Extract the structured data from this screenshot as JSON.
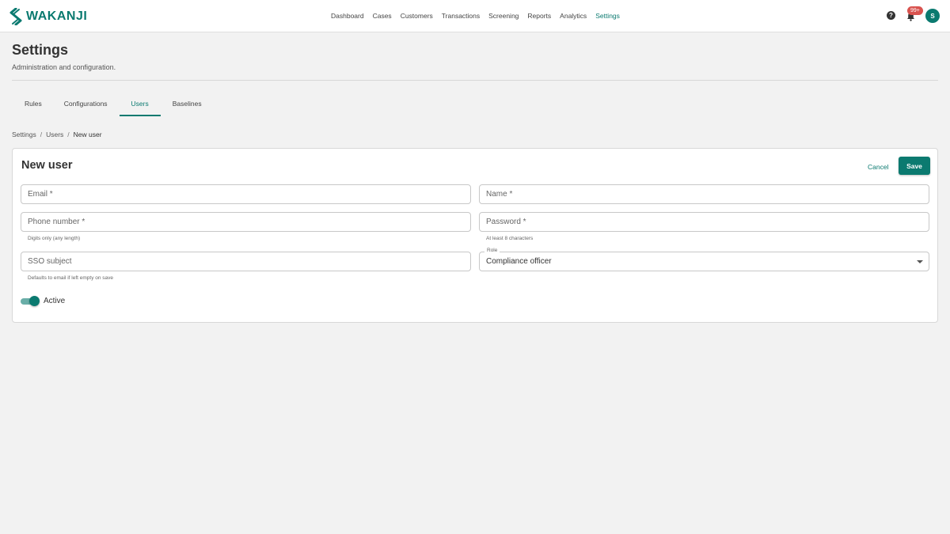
{
  "brand": {
    "name": "WAKANJI",
    "color": "#0b7a70"
  },
  "nav": {
    "items": [
      {
        "label": "Dashboard"
      },
      {
        "label": "Cases"
      },
      {
        "label": "Customers"
      },
      {
        "label": "Transactions"
      },
      {
        "label": "Screening"
      },
      {
        "label": "Reports"
      },
      {
        "label": "Analytics"
      },
      {
        "label": "Settings",
        "active": true
      }
    ],
    "help_icon": "help-circle-icon",
    "bell_icon": "bell-icon",
    "notification_badge": "99+",
    "avatar_initial": "S"
  },
  "header": {
    "title": "Settings",
    "subtitle": "Administration and configuration."
  },
  "tabs": [
    {
      "label": "Rules"
    },
    {
      "label": "Configurations"
    },
    {
      "label": "Users",
      "active": true
    },
    {
      "label": "Baselines"
    }
  ],
  "breadcrumb": [
    "Settings",
    "Users",
    "New user"
  ],
  "form": {
    "title": "New user",
    "cancel_label": "Cancel",
    "save_label": "Save",
    "email": {
      "placeholder": "Email *",
      "value": ""
    },
    "name": {
      "placeholder": "Name *",
      "value": ""
    },
    "phone": {
      "placeholder": "Phone number *",
      "value": "",
      "helper": "Digits only (any length)"
    },
    "password": {
      "placeholder": "Password *",
      "value": "",
      "helper": "At least 8 characters"
    },
    "sso": {
      "placeholder": "SSO subject",
      "value": "",
      "helper": "Defaults to email if left empty on save"
    },
    "role": {
      "label": "Role",
      "value": "Compliance officer"
    },
    "active": {
      "label": "Active",
      "on": true
    }
  }
}
